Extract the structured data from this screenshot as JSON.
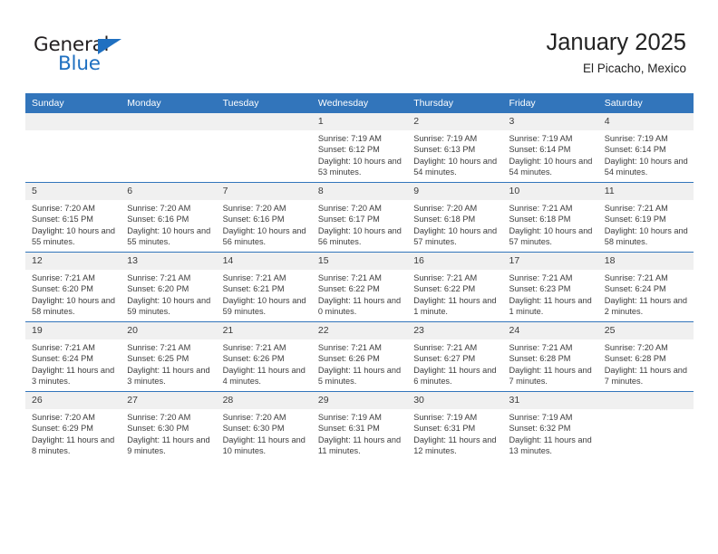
{
  "brand": {
    "name_part1": "General",
    "name_part2": "Blue",
    "accent_color": "#1f70c1"
  },
  "header": {
    "title": "January 2025",
    "subtitle": "El Picacho, Mexico"
  },
  "calendar": {
    "header_color": "#3275bb",
    "daynum_band_color": "#f0f0f0",
    "weekdays": [
      "Sunday",
      "Monday",
      "Tuesday",
      "Wednesday",
      "Thursday",
      "Friday",
      "Saturday"
    ],
    "labels": {
      "sunrise": "Sunrise:",
      "sunset": "Sunset:",
      "daylight": "Daylight:"
    },
    "weeks": [
      [
        {
          "day": "",
          "empty": true
        },
        {
          "day": "",
          "empty": true
        },
        {
          "day": "",
          "empty": true
        },
        {
          "day": "1",
          "sunrise": "Sunrise: 7:19 AM",
          "sunset": "Sunset: 6:12 PM",
          "daylight": "Daylight: 10 hours and 53 minutes."
        },
        {
          "day": "2",
          "sunrise": "Sunrise: 7:19 AM",
          "sunset": "Sunset: 6:13 PM",
          "daylight": "Daylight: 10 hours and 54 minutes."
        },
        {
          "day": "3",
          "sunrise": "Sunrise: 7:19 AM",
          "sunset": "Sunset: 6:14 PM",
          "daylight": "Daylight: 10 hours and 54 minutes."
        },
        {
          "day": "4",
          "sunrise": "Sunrise: 7:19 AM",
          "sunset": "Sunset: 6:14 PM",
          "daylight": "Daylight: 10 hours and 54 minutes."
        }
      ],
      [
        {
          "day": "5",
          "sunrise": "Sunrise: 7:20 AM",
          "sunset": "Sunset: 6:15 PM",
          "daylight": "Daylight: 10 hours and 55 minutes."
        },
        {
          "day": "6",
          "sunrise": "Sunrise: 7:20 AM",
          "sunset": "Sunset: 6:16 PM",
          "daylight": "Daylight: 10 hours and 55 minutes."
        },
        {
          "day": "7",
          "sunrise": "Sunrise: 7:20 AM",
          "sunset": "Sunset: 6:16 PM",
          "daylight": "Daylight: 10 hours and 56 minutes."
        },
        {
          "day": "8",
          "sunrise": "Sunrise: 7:20 AM",
          "sunset": "Sunset: 6:17 PM",
          "daylight": "Daylight: 10 hours and 56 minutes."
        },
        {
          "day": "9",
          "sunrise": "Sunrise: 7:20 AM",
          "sunset": "Sunset: 6:18 PM",
          "daylight": "Daylight: 10 hours and 57 minutes."
        },
        {
          "day": "10",
          "sunrise": "Sunrise: 7:21 AM",
          "sunset": "Sunset: 6:18 PM",
          "daylight": "Daylight: 10 hours and 57 minutes."
        },
        {
          "day": "11",
          "sunrise": "Sunrise: 7:21 AM",
          "sunset": "Sunset: 6:19 PM",
          "daylight": "Daylight: 10 hours and 58 minutes."
        }
      ],
      [
        {
          "day": "12",
          "sunrise": "Sunrise: 7:21 AM",
          "sunset": "Sunset: 6:20 PM",
          "daylight": "Daylight: 10 hours and 58 minutes."
        },
        {
          "day": "13",
          "sunrise": "Sunrise: 7:21 AM",
          "sunset": "Sunset: 6:20 PM",
          "daylight": "Daylight: 10 hours and 59 minutes."
        },
        {
          "day": "14",
          "sunrise": "Sunrise: 7:21 AM",
          "sunset": "Sunset: 6:21 PM",
          "daylight": "Daylight: 10 hours and 59 minutes."
        },
        {
          "day": "15",
          "sunrise": "Sunrise: 7:21 AM",
          "sunset": "Sunset: 6:22 PM",
          "daylight": "Daylight: 11 hours and 0 minutes."
        },
        {
          "day": "16",
          "sunrise": "Sunrise: 7:21 AM",
          "sunset": "Sunset: 6:22 PM",
          "daylight": "Daylight: 11 hours and 1 minute."
        },
        {
          "day": "17",
          "sunrise": "Sunrise: 7:21 AM",
          "sunset": "Sunset: 6:23 PM",
          "daylight": "Daylight: 11 hours and 1 minute."
        },
        {
          "day": "18",
          "sunrise": "Sunrise: 7:21 AM",
          "sunset": "Sunset: 6:24 PM",
          "daylight": "Daylight: 11 hours and 2 minutes."
        }
      ],
      [
        {
          "day": "19",
          "sunrise": "Sunrise: 7:21 AM",
          "sunset": "Sunset: 6:24 PM",
          "daylight": "Daylight: 11 hours and 3 minutes."
        },
        {
          "day": "20",
          "sunrise": "Sunrise: 7:21 AM",
          "sunset": "Sunset: 6:25 PM",
          "daylight": "Daylight: 11 hours and 3 minutes."
        },
        {
          "day": "21",
          "sunrise": "Sunrise: 7:21 AM",
          "sunset": "Sunset: 6:26 PM",
          "daylight": "Daylight: 11 hours and 4 minutes."
        },
        {
          "day": "22",
          "sunrise": "Sunrise: 7:21 AM",
          "sunset": "Sunset: 6:26 PM",
          "daylight": "Daylight: 11 hours and 5 minutes."
        },
        {
          "day": "23",
          "sunrise": "Sunrise: 7:21 AM",
          "sunset": "Sunset: 6:27 PM",
          "daylight": "Daylight: 11 hours and 6 minutes."
        },
        {
          "day": "24",
          "sunrise": "Sunrise: 7:21 AM",
          "sunset": "Sunset: 6:28 PM",
          "daylight": "Daylight: 11 hours and 7 minutes."
        },
        {
          "day": "25",
          "sunrise": "Sunrise: 7:20 AM",
          "sunset": "Sunset: 6:28 PM",
          "daylight": "Daylight: 11 hours and 7 minutes."
        }
      ],
      [
        {
          "day": "26",
          "sunrise": "Sunrise: 7:20 AM",
          "sunset": "Sunset: 6:29 PM",
          "daylight": "Daylight: 11 hours and 8 minutes."
        },
        {
          "day": "27",
          "sunrise": "Sunrise: 7:20 AM",
          "sunset": "Sunset: 6:30 PM",
          "daylight": "Daylight: 11 hours and 9 minutes."
        },
        {
          "day": "28",
          "sunrise": "Sunrise: 7:20 AM",
          "sunset": "Sunset: 6:30 PM",
          "daylight": "Daylight: 11 hours and 10 minutes."
        },
        {
          "day": "29",
          "sunrise": "Sunrise: 7:19 AM",
          "sunset": "Sunset: 6:31 PM",
          "daylight": "Daylight: 11 hours and 11 minutes."
        },
        {
          "day": "30",
          "sunrise": "Sunrise: 7:19 AM",
          "sunset": "Sunset: 6:31 PM",
          "daylight": "Daylight: 11 hours and 12 minutes."
        },
        {
          "day": "31",
          "sunrise": "Sunrise: 7:19 AM",
          "sunset": "Sunset: 6:32 PM",
          "daylight": "Daylight: 11 hours and 13 minutes."
        },
        {
          "day": "",
          "empty": true
        }
      ]
    ]
  }
}
